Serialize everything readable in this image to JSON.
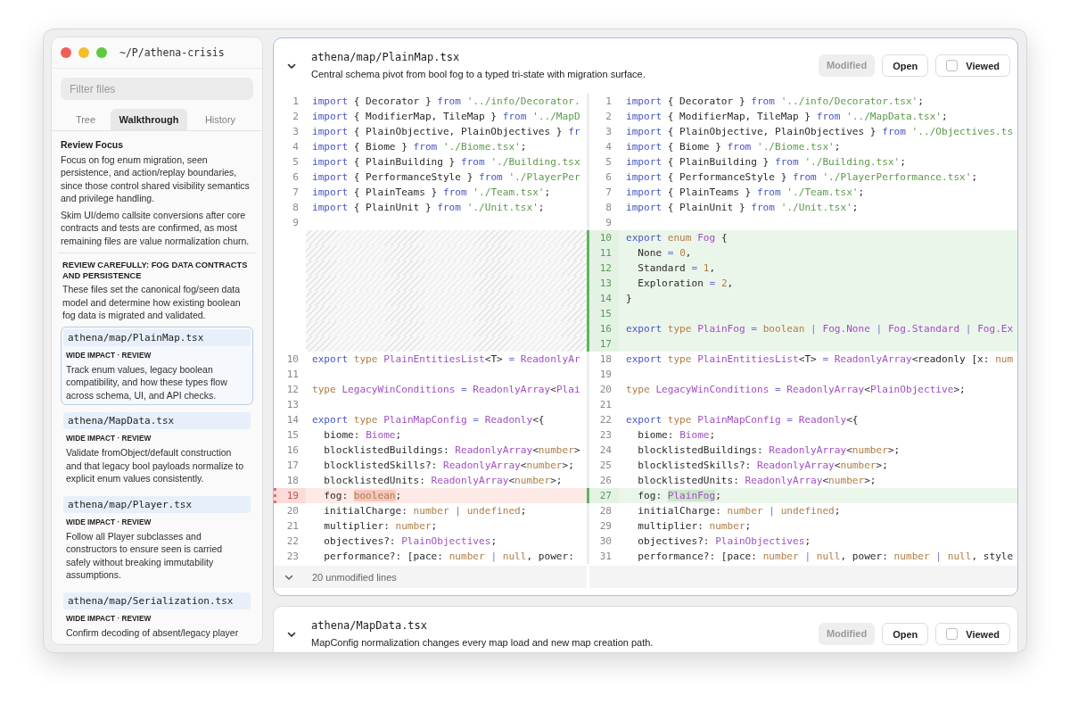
{
  "window": {
    "title": "~/P/athena-crisis"
  },
  "sidebar": {
    "filter": {
      "placeholder": "Filter files"
    },
    "tabs": [
      {
        "label": "Tree",
        "selected": false
      },
      {
        "label": "Walkthrough",
        "selected": true
      },
      {
        "label": "History",
        "selected": false
      }
    ],
    "focus": {
      "heading": "Review Focus",
      "paragraphs": [
        "Focus on fog enum migration, seen persistence, and action/replay boundaries, since those control shared visibility semantics and privilege handling.",
        "Skim UI/demo callsite conversions after core contracts and tests are confirmed, as most remaining files are value normalization churn."
      ]
    },
    "section": {
      "heading": "REVIEW CAREFULLY: FOG DATA CONTRACTS AND PERSISTENCE",
      "description": "These files set the canonical fog/seen data model and determine how existing boolean fog data is migrated and validated."
    },
    "files": [
      {
        "path": "athena/map/PlainMap.tsx",
        "impact": "WIDE IMPACT · REVIEW",
        "description": "Track enum values, legacy boolean compatibility, and how these types flow across schema, UI, and API checks.",
        "selected": true
      },
      {
        "path": "athena/MapData.tsx",
        "impact": "WIDE IMPACT · REVIEW",
        "description": "Validate fromObject/default construction and that legacy bool payloads normalize to explicit enum values consistently.",
        "selected": false
      },
      {
        "path": "athena/map/Player.tsx",
        "impact": "WIDE IMPACT · REVIEW",
        "description": "Follow all Player subclasses and constructors to ensure seen is carried safely without breaking immutability assumptions.",
        "selected": false
      },
      {
        "path": "athena/map/Serialization.tsx",
        "impact": "WIDE IMPACT · REVIEW",
        "description": "Confirm decoding of absent/legacy player",
        "selected": false
      }
    ]
  },
  "diffs": [
    {
      "path": "athena/map/PlainMap.tsx",
      "description": "Central schema pivot from bool fog to a typed tri-state with migration surface.",
      "status": "Modified",
      "open_label": "Open",
      "viewed": {
        "label": "Viewed",
        "checked": false
      },
      "selected": true,
      "rows": [
        {
          "left": {
            "num": "1",
            "kind": "context",
            "tokens": [
              {
                "kind": "keyword",
                "text": "import"
              },
              {
                "kind": "plain",
                "text": " { Decorator } "
              },
              {
                "kind": "keyword",
                "text": "from "
              },
              {
                "kind": "string",
                "text": "'../info/Decorator."
              }
            ]
          },
          "right": {
            "num": "1",
            "kind": "context",
            "tokens": [
              {
                "kind": "keyword",
                "text": "import"
              },
              {
                "kind": "plain",
                "text": " { Decorator } "
              },
              {
                "kind": "keyword",
                "text": "from "
              },
              {
                "kind": "string",
                "text": "'../info/Decorator.tsx'"
              },
              {
                "kind": "plain",
                "text": ";"
              }
            ]
          }
        },
        {
          "left": {
            "num": "2",
            "kind": "context",
            "tokens": [
              {
                "kind": "keyword",
                "text": "import"
              },
              {
                "kind": "plain",
                "text": " { ModifierMap, TileMap } "
              },
              {
                "kind": "keyword",
                "text": "from "
              },
              {
                "kind": "string",
                "text": "'../MapD"
              }
            ]
          },
          "right": {
            "num": "2",
            "kind": "context",
            "tokens": [
              {
                "kind": "keyword",
                "text": "import"
              },
              {
                "kind": "plain",
                "text": " { ModifierMap, TileMap } "
              },
              {
                "kind": "keyword",
                "text": "from "
              },
              {
                "kind": "string",
                "text": "'../MapData.tsx'"
              },
              {
                "kind": "plain",
                "text": ";"
              }
            ]
          }
        },
        {
          "left": {
            "num": "3",
            "kind": "context",
            "tokens": [
              {
                "kind": "keyword",
                "text": "import"
              },
              {
                "kind": "plain",
                "text": " { PlainObjective, PlainObjectives } "
              },
              {
                "kind": "keyword",
                "text": "fr"
              }
            ]
          },
          "right": {
            "num": "3",
            "kind": "context",
            "tokens": [
              {
                "kind": "keyword",
                "text": "import"
              },
              {
                "kind": "plain",
                "text": " { PlainObjective, PlainObjectives } "
              },
              {
                "kind": "keyword",
                "text": "from "
              },
              {
                "kind": "string",
                "text": "'../Objectives.ts"
              }
            ]
          }
        },
        {
          "left": {
            "num": "4",
            "kind": "context",
            "tokens": [
              {
                "kind": "keyword",
                "text": "import"
              },
              {
                "kind": "plain",
                "text": " { Biome } "
              },
              {
                "kind": "keyword",
                "text": "from "
              },
              {
                "kind": "string",
                "text": "'./Biome.tsx'"
              },
              {
                "kind": "plain",
                "text": ";"
              }
            ]
          },
          "right": {
            "num": "4",
            "kind": "context",
            "tokens": [
              {
                "kind": "keyword",
                "text": "import"
              },
              {
                "kind": "plain",
                "text": " { Biome } "
              },
              {
                "kind": "keyword",
                "text": "from "
              },
              {
                "kind": "string",
                "text": "'./Biome.tsx'"
              },
              {
                "kind": "plain",
                "text": ";"
              }
            ]
          }
        },
        {
          "left": {
            "num": "5",
            "kind": "context",
            "tokens": [
              {
                "kind": "keyword",
                "text": "import"
              },
              {
                "kind": "plain",
                "text": " { PlainBuilding } "
              },
              {
                "kind": "keyword",
                "text": "from "
              },
              {
                "kind": "string",
                "text": "'./Building.tsx"
              }
            ]
          },
          "right": {
            "num": "5",
            "kind": "context",
            "tokens": [
              {
                "kind": "keyword",
                "text": "import"
              },
              {
                "kind": "plain",
                "text": " { PlainBuilding } "
              },
              {
                "kind": "keyword",
                "text": "from "
              },
              {
                "kind": "string",
                "text": "'./Building.tsx'"
              },
              {
                "kind": "plain",
                "text": ";"
              }
            ]
          }
        },
        {
          "left": {
            "num": "6",
            "kind": "context",
            "tokens": [
              {
                "kind": "keyword",
                "text": "import"
              },
              {
                "kind": "plain",
                "text": " { PerformanceStyle } "
              },
              {
                "kind": "keyword",
                "text": "from "
              },
              {
                "kind": "string",
                "text": "'./PlayerPer"
              }
            ]
          },
          "right": {
            "num": "6",
            "kind": "context",
            "tokens": [
              {
                "kind": "keyword",
                "text": "import"
              },
              {
                "kind": "plain",
                "text": " { PerformanceStyle } "
              },
              {
                "kind": "keyword",
                "text": "from "
              },
              {
                "kind": "string",
                "text": "'./PlayerPerformance.tsx'"
              },
              {
                "kind": "plain",
                "text": ";"
              }
            ]
          }
        },
        {
          "left": {
            "num": "7",
            "kind": "context",
            "tokens": [
              {
                "kind": "keyword",
                "text": "import"
              },
              {
                "kind": "plain",
                "text": " { PlainTeams } "
              },
              {
                "kind": "keyword",
                "text": "from "
              },
              {
                "kind": "string",
                "text": "'./Team.tsx'"
              },
              {
                "kind": "plain",
                "text": ";"
              }
            ]
          },
          "right": {
            "num": "7",
            "kind": "context",
            "tokens": [
              {
                "kind": "keyword",
                "text": "import"
              },
              {
                "kind": "plain",
                "text": " { PlainTeams } "
              },
              {
                "kind": "keyword",
                "text": "from "
              },
              {
                "kind": "string",
                "text": "'./Team.tsx'"
              },
              {
                "kind": "plain",
                "text": ";"
              }
            ]
          }
        },
        {
          "left": {
            "num": "8",
            "kind": "context",
            "tokens": [
              {
                "kind": "keyword",
                "text": "import"
              },
              {
                "kind": "plain",
                "text": " { PlainUnit } "
              },
              {
                "kind": "keyword",
                "text": "from "
              },
              {
                "kind": "string",
                "text": "'./Unit.tsx'"
              },
              {
                "kind": "plain",
                "text": ";"
              }
            ]
          },
          "right": {
            "num": "8",
            "kind": "context",
            "tokens": [
              {
                "kind": "keyword",
                "text": "import"
              },
              {
                "kind": "plain",
                "text": " { PlainUnit } "
              },
              {
                "kind": "keyword",
                "text": "from "
              },
              {
                "kind": "string",
                "text": "'./Unit.tsx'"
              },
              {
                "kind": "plain",
                "text": ";"
              }
            ]
          }
        },
        {
          "left": {
            "num": "9",
            "kind": "context"
          },
          "right": {
            "num": "9",
            "kind": "context"
          }
        },
        {
          "left": {
            "kind": "filler"
          },
          "right": {
            "num": "10",
            "kind": "added",
            "tokens": [
              {
                "kind": "keyword",
                "text": "export "
              },
              {
                "kind": "literal",
                "text": "enum "
              },
              {
                "kind": "name",
                "text": "Fog"
              },
              {
                "kind": "plain",
                "text": " {"
              }
            ]
          }
        },
        {
          "left": {
            "kind": "filler"
          },
          "right": {
            "num": "11",
            "kind": "added",
            "tokens": [
              {
                "kind": "plain",
                "text": "  None "
              },
              {
                "kind": "operator",
                "text": "= "
              },
              {
                "kind": "literal",
                "text": "0"
              },
              {
                "kind": "plain",
                "text": ","
              }
            ]
          }
        },
        {
          "left": {
            "kind": "filler"
          },
          "right": {
            "num": "12",
            "kind": "added",
            "tokens": [
              {
                "kind": "plain",
                "text": "  Standard "
              },
              {
                "kind": "operator",
                "text": "= "
              },
              {
                "kind": "literal",
                "text": "1"
              },
              {
                "kind": "plain",
                "text": ","
              }
            ]
          }
        },
        {
          "left": {
            "kind": "filler"
          },
          "right": {
            "num": "13",
            "kind": "added",
            "tokens": [
              {
                "kind": "plain",
                "text": "  Exploration "
              },
              {
                "kind": "operator",
                "text": "= "
              },
              {
                "kind": "literal",
                "text": "2"
              },
              {
                "kind": "plain",
                "text": ","
              }
            ]
          }
        },
        {
          "left": {
            "kind": "filler"
          },
          "right": {
            "num": "14",
            "kind": "added",
            "tokens": [
              {
                "kind": "plain",
                "text": "}"
              }
            ]
          }
        },
        {
          "left": {
            "kind": "filler"
          },
          "right": {
            "num": "15",
            "kind": "added"
          }
        },
        {
          "left": {
            "kind": "filler"
          },
          "right": {
            "num": "16",
            "kind": "added",
            "tokens": [
              {
                "kind": "keyword",
                "text": "export "
              },
              {
                "kind": "literal",
                "text": "type "
              },
              {
                "kind": "name",
                "text": "PlainFog "
              },
              {
                "kind": "operator",
                "text": "= "
              },
              {
                "kind": "literal",
                "text": "boolean "
              },
              {
                "kind": "operator",
                "text": "| "
              },
              {
                "kind": "name",
                "text": "Fog.None "
              },
              {
                "kind": "operator",
                "text": "| "
              },
              {
                "kind": "name",
                "text": "Fog.Standard "
              },
              {
                "kind": "operator",
                "text": "| "
              },
              {
                "kind": "name",
                "text": "Fog.Ex"
              }
            ]
          }
        },
        {
          "left": {
            "kind": "filler"
          },
          "right": {
            "num": "17",
            "kind": "added"
          }
        },
        {
          "left": {
            "num": "10",
            "kind": "context",
            "tokens": [
              {
                "kind": "keyword",
                "text": "export "
              },
              {
                "kind": "literal",
                "text": "type "
              },
              {
                "kind": "name",
                "text": "PlainEntitiesList"
              },
              {
                "kind": "plain",
                "text": "<T> "
              },
              {
                "kind": "operator",
                "text": "= "
              },
              {
                "kind": "name",
                "text": "ReadonlyAr"
              }
            ]
          },
          "right": {
            "num": "18",
            "kind": "context",
            "tokens": [
              {
                "kind": "keyword",
                "text": "export "
              },
              {
                "kind": "literal",
                "text": "type "
              },
              {
                "kind": "name",
                "text": "PlainEntitiesList"
              },
              {
                "kind": "plain",
                "text": "<T> "
              },
              {
                "kind": "operator",
                "text": "= "
              },
              {
                "kind": "name",
                "text": "ReadonlyArray"
              },
              {
                "kind": "plain",
                "text": "<readonly [x: "
              },
              {
                "kind": "literal",
                "text": "num"
              }
            ]
          }
        },
        {
          "left": {
            "num": "11",
            "kind": "context"
          },
          "right": {
            "num": "19",
            "kind": "context"
          }
        },
        {
          "left": {
            "num": "12",
            "kind": "context",
            "tokens": [
              {
                "kind": "literal",
                "text": "type "
              },
              {
                "kind": "name",
                "text": "LegacyWinConditions "
              },
              {
                "kind": "operator",
                "text": "= "
              },
              {
                "kind": "name",
                "text": "ReadonlyArray"
              },
              {
                "kind": "plain",
                "text": "<"
              },
              {
                "kind": "name",
                "text": "Plai"
              }
            ]
          },
          "right": {
            "num": "20",
            "kind": "context",
            "tokens": [
              {
                "kind": "literal",
                "text": "type "
              },
              {
                "kind": "name",
                "text": "LegacyWinConditions "
              },
              {
                "kind": "operator",
                "text": "= "
              },
              {
                "kind": "name",
                "text": "ReadonlyArray"
              },
              {
                "kind": "plain",
                "text": "<"
              },
              {
                "kind": "name",
                "text": "PlainObjective"
              },
              {
                "kind": "plain",
                "text": ">;"
              }
            ]
          }
        },
        {
          "left": {
            "num": "13",
            "kind": "context"
          },
          "right": {
            "num": "21",
            "kind": "context"
          }
        },
        {
          "left": {
            "num": "14",
            "kind": "context",
            "tokens": [
              {
                "kind": "keyword",
                "text": "export "
              },
              {
                "kind": "literal",
                "text": "type "
              },
              {
                "kind": "name",
                "text": "PlainMapConfig "
              },
              {
                "kind": "operator",
                "text": "= "
              },
              {
                "kind": "name",
                "text": "Readonly"
              },
              {
                "kind": "plain",
                "text": "<{"
              }
            ]
          },
          "right": {
            "num": "22",
            "kind": "context",
            "tokens": [
              {
                "kind": "keyword",
                "text": "export "
              },
              {
                "kind": "literal",
                "text": "type "
              },
              {
                "kind": "name",
                "text": "PlainMapConfig "
              },
              {
                "kind": "operator",
                "text": "= "
              },
              {
                "kind": "name",
                "text": "Readonly"
              },
              {
                "kind": "plain",
                "text": "<{"
              }
            ]
          }
        },
        {
          "left": {
            "num": "15",
            "kind": "context",
            "tokens": [
              {
                "kind": "plain",
                "text": "  biome: "
              },
              {
                "kind": "name",
                "text": "Biome"
              },
              {
                "kind": "plain",
                "text": ";"
              }
            ]
          },
          "right": {
            "num": "23",
            "kind": "context",
            "tokens": [
              {
                "kind": "plain",
                "text": "  biome: "
              },
              {
                "kind": "name",
                "text": "Biome"
              },
              {
                "kind": "plain",
                "text": ";"
              }
            ]
          }
        },
        {
          "left": {
            "num": "16",
            "kind": "context",
            "tokens": [
              {
                "kind": "plain",
                "text": "  blocklistedBuildings: "
              },
              {
                "kind": "name",
                "text": "ReadonlyArray"
              },
              {
                "kind": "plain",
                "text": "<"
              },
              {
                "kind": "literal",
                "text": "number"
              },
              {
                "kind": "plain",
                "text": ">"
              }
            ]
          },
          "right": {
            "num": "24",
            "kind": "context",
            "tokens": [
              {
                "kind": "plain",
                "text": "  blocklistedBuildings: "
              },
              {
                "kind": "name",
                "text": "ReadonlyArray"
              },
              {
                "kind": "plain",
                "text": "<"
              },
              {
                "kind": "literal",
                "text": "number"
              },
              {
                "kind": "plain",
                "text": ">;"
              }
            ]
          }
        },
        {
          "left": {
            "num": "17",
            "kind": "context",
            "tokens": [
              {
                "kind": "plain",
                "text": "  blocklistedSkills?: "
              },
              {
                "kind": "name",
                "text": "ReadonlyArray"
              },
              {
                "kind": "plain",
                "text": "<"
              },
              {
                "kind": "literal",
                "text": "number"
              },
              {
                "kind": "plain",
                "text": ">;"
              }
            ]
          },
          "right": {
            "num": "25",
            "kind": "context",
            "tokens": [
              {
                "kind": "plain",
                "text": "  blocklistedSkills?: "
              },
              {
                "kind": "name",
                "text": "ReadonlyArray"
              },
              {
                "kind": "plain",
                "text": "<"
              },
              {
                "kind": "literal",
                "text": "number"
              },
              {
                "kind": "plain",
                "text": ">;"
              }
            ]
          }
        },
        {
          "left": {
            "num": "18",
            "kind": "context",
            "tokens": [
              {
                "kind": "plain",
                "text": "  blocklistedUnits: "
              },
              {
                "kind": "name",
                "text": "ReadonlyArray"
              },
              {
                "kind": "plain",
                "text": "<"
              },
              {
                "kind": "literal",
                "text": "number"
              },
              {
                "kind": "plain",
                "text": ">;"
              }
            ]
          },
          "right": {
            "num": "26",
            "kind": "context",
            "tokens": [
              {
                "kind": "plain",
                "text": "  blocklistedUnits: "
              },
              {
                "kind": "name",
                "text": "ReadonlyArray"
              },
              {
                "kind": "plain",
                "text": "<"
              },
              {
                "kind": "literal",
                "text": "number"
              },
              {
                "kind": "plain",
                "text": ">;"
              }
            ]
          }
        },
        {
          "left": {
            "num": "19",
            "kind": "removed",
            "tokens": [
              {
                "kind": "plain",
                "text": "  fog: "
              },
              {
                "kind": "removed-word",
                "text": "boolean"
              },
              {
                "kind": "plain",
                "text": ";"
              }
            ]
          },
          "right": {
            "num": "27",
            "kind": "added",
            "tokens": [
              {
                "kind": "plain",
                "text": "  fog: "
              },
              {
                "kind": "added-word",
                "text": "PlainFog"
              },
              {
                "kind": "plain",
                "text": ";"
              }
            ]
          }
        },
        {
          "left": {
            "num": "20",
            "kind": "context",
            "tokens": [
              {
                "kind": "plain",
                "text": "  initialCharge: "
              },
              {
                "kind": "literal",
                "text": "number "
              },
              {
                "kind": "operator",
                "text": "| "
              },
              {
                "kind": "literal",
                "text": "undefined"
              },
              {
                "kind": "plain",
                "text": ";"
              }
            ]
          },
          "right": {
            "num": "28",
            "kind": "context",
            "tokens": [
              {
                "kind": "plain",
                "text": "  initialCharge: "
              },
              {
                "kind": "literal",
                "text": "number "
              },
              {
                "kind": "operator",
                "text": "| "
              },
              {
                "kind": "literal",
                "text": "undefined"
              },
              {
                "kind": "plain",
                "text": ";"
              }
            ]
          }
        },
        {
          "left": {
            "num": "21",
            "kind": "context",
            "tokens": [
              {
                "kind": "plain",
                "text": "  multiplier: "
              },
              {
                "kind": "literal",
                "text": "number"
              },
              {
                "kind": "plain",
                "text": ";"
              }
            ]
          },
          "right": {
            "num": "29",
            "kind": "context",
            "tokens": [
              {
                "kind": "plain",
                "text": "  multiplier: "
              },
              {
                "kind": "literal",
                "text": "number"
              },
              {
                "kind": "plain",
                "text": ";"
              }
            ]
          }
        },
        {
          "left": {
            "num": "22",
            "kind": "context",
            "tokens": [
              {
                "kind": "plain",
                "text": "  objectives?: "
              },
              {
                "kind": "name",
                "text": "PlainObjectives"
              },
              {
                "kind": "plain",
                "text": ";"
              }
            ]
          },
          "right": {
            "num": "30",
            "kind": "context",
            "tokens": [
              {
                "kind": "plain",
                "text": "  objectives?: "
              },
              {
                "kind": "name",
                "text": "PlainObjectives"
              },
              {
                "kind": "plain",
                "text": ";"
              }
            ]
          }
        },
        {
          "left": {
            "num": "23",
            "kind": "context",
            "tokens": [
              {
                "kind": "plain",
                "text": "  performance?: [pace: "
              },
              {
                "kind": "literal",
                "text": "number "
              },
              {
                "kind": "operator",
                "text": "| "
              },
              {
                "kind": "literal",
                "text": "null"
              },
              {
                "kind": "plain",
                "text": ", power:"
              }
            ]
          },
          "right": {
            "num": "31",
            "kind": "context",
            "tokens": [
              {
                "kind": "plain",
                "text": "  performance?: [pace: "
              },
              {
                "kind": "literal",
                "text": "number "
              },
              {
                "kind": "operator",
                "text": "| "
              },
              {
                "kind": "literal",
                "text": "null"
              },
              {
                "kind": "plain",
                "text": ", power: "
              },
              {
                "kind": "literal",
                "text": "number "
              },
              {
                "kind": "operator",
                "text": "| "
              },
              {
                "kind": "literal",
                "text": "null"
              },
              {
                "kind": "plain",
                "text": ", style"
              }
            ]
          }
        }
      ],
      "collapsed": {
        "label": "20 unmodified lines"
      }
    },
    {
      "path": "athena/MapData.tsx",
      "description": "MapConfig normalization changes every map load and new map creation path.",
      "status": "Modified",
      "open_label": "Open",
      "viewed": {
        "label": "Viewed",
        "checked": false
      },
      "selected": false
    }
  ]
}
